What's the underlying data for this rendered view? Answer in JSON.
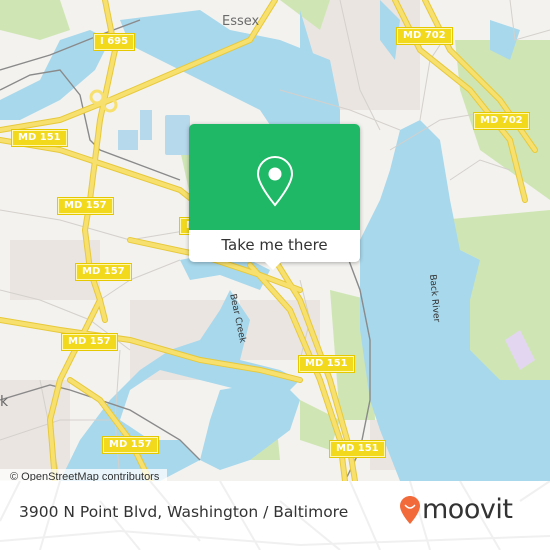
{
  "map": {
    "place_labels": [
      {
        "id": "essex",
        "text": "Essex"
      },
      {
        "id": "k-partial",
        "text": "k"
      }
    ],
    "water_labels": [
      {
        "id": "bear-creek",
        "text": "Bear Creek"
      },
      {
        "id": "back-river",
        "text": "Back River"
      }
    ],
    "road_labels": [
      {
        "id": "i695",
        "text": "I 695"
      },
      {
        "id": "md702-a",
        "text": "MD 702"
      },
      {
        "id": "md702-b",
        "text": "MD 702"
      },
      {
        "id": "md151-a",
        "text": "MD 151"
      },
      {
        "id": "md151-b",
        "text": "MD 151"
      },
      {
        "id": "md151-c",
        "text": "MD 151"
      },
      {
        "id": "md157-a",
        "text": "MD 157"
      },
      {
        "id": "md157-b",
        "text": "MD 157"
      },
      {
        "id": "md157-c",
        "text": "MD 157"
      },
      {
        "id": "md157-d",
        "text": "MD 157"
      },
      {
        "id": "md-partial",
        "text": "M"
      }
    ],
    "attribution": "© OpenStreetMap contributors",
    "colors": {
      "land": "#f3f2ef",
      "water": "#a8d8ec",
      "park": "#cfe6b4",
      "road": "#f7e06e",
      "urban": "#ebe5e2"
    }
  },
  "popup": {
    "icon": "location-pin-icon",
    "button_label": "Take me there",
    "color": "#1fb866"
  },
  "footer": {
    "address": "3900 N Point Blvd, Washington / Baltimore",
    "brand": {
      "name": "moovit",
      "icon": "moovit-smile-pin-icon",
      "color": "#f26a3a"
    }
  }
}
